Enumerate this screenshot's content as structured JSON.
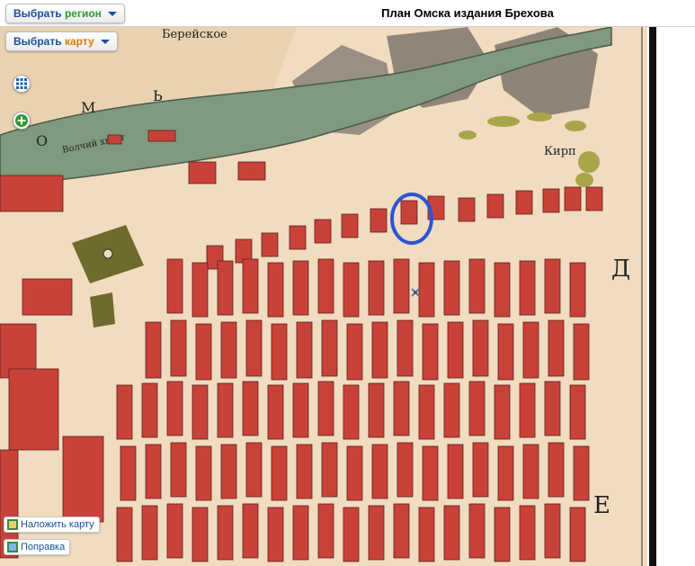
{
  "header": {
    "title": "План Омска издания Брехова",
    "region_button": {
      "word1": "Выбрать",
      "word2": "регион"
    },
    "map_button": {
      "word1": "Выбрать",
      "word2": "карту"
    }
  },
  "map": {
    "labels": {
      "top_area": "Берейское",
      "river_letters": [
        "О",
        "М",
        "Ь"
      ],
      "tail_label": "Волчий хвост",
      "kirp_label": "Кирп",
      "big_letter_d": "Д",
      "big_letter_e": "Е"
    }
  },
  "controls": {
    "overlay_button": "Наложить карту",
    "correction_button": "Поправка"
  },
  "icons": {
    "grid": "grid-icon",
    "zoom": "zoom-in-icon",
    "overlay": "overlay-map-icon",
    "correction": "correction-icon",
    "highlight": "highlight-ellipse",
    "marker": "cross-marker-icon"
  },
  "colors": {
    "paper": "#f1dcc0",
    "river": "#7f9a7e",
    "block": "#c9423a",
    "highlight": "#2a55d4",
    "accent_green": "#2f9a2f",
    "accent_orange": "#e07a00"
  }
}
